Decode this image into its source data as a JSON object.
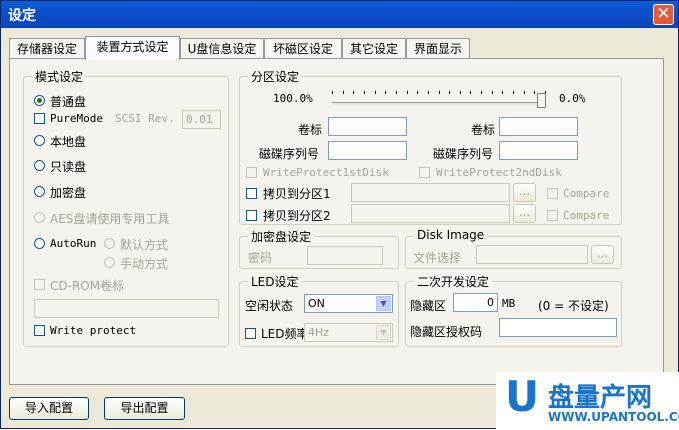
{
  "window": {
    "title": "设定",
    "close_glyph": "✕"
  },
  "tabs": [
    {
      "label": "存储器设定",
      "active": false
    },
    {
      "label": "装置方式设定",
      "active": true
    },
    {
      "label": "U盘信息设定",
      "active": false
    },
    {
      "label": "坏磁区设定",
      "active": false
    },
    {
      "label": "其它设定",
      "active": false
    },
    {
      "label": "界面显示",
      "active": false
    }
  ],
  "mode_group": {
    "legend": "模式设定",
    "normal": "普通盘",
    "puremode": "PureMode",
    "scsi_rev_label": "SCSI Rev.",
    "scsi_rev_value": "0.01",
    "local": "本地盘",
    "readonly": "只读盘",
    "encrypted": "加密盘",
    "aes": "AES盘请使用专用工具",
    "autorun": "AutoRun",
    "default_mode": "默认方式",
    "manual_mode": "手动方式",
    "cdrom_label": "CD-ROM卷标",
    "write_protect": "Write protect"
  },
  "partition_group": {
    "legend": "分区设定",
    "left_percent": "100.0%",
    "right_percent": "0.0%",
    "slider_value_percent": 100,
    "volume_label": "卷标",
    "serial_label": "磁碟序列号",
    "wp1": "WriteProtect1stDisk",
    "wp2": "WriteProtect2ndDisk",
    "copy1": "拷贝到分区1",
    "copy2": "拷贝到分区2",
    "browse": "...",
    "compare": "Compare"
  },
  "encrypt_group": {
    "legend": "加密盘设定",
    "password_label": "密码"
  },
  "disk_image_group": {
    "legend": "Disk Image",
    "file_select_label": "文件选择",
    "browse": "..."
  },
  "led_group": {
    "legend": "LED设定",
    "idle_label": "空闲状态",
    "idle_value": "ON",
    "freq_label": "LED频率",
    "freq_value": "4Hz"
  },
  "dev_group": {
    "legend": "二次开发设定",
    "hidden_label": "隐藏区",
    "hidden_value": "0",
    "hidden_unit": "MB",
    "hidden_note": "(0 = 不设定)",
    "auth_label": "隐藏区授权码"
  },
  "bottom": {
    "import_label": "导入配置",
    "export_label": "导出配置"
  },
  "watermark": {
    "logo_letter": "U",
    "text": "盘量产网",
    "url": "WWW.UPANTOOL.COM"
  },
  "colors": {
    "titlebar": "#0a5fd8",
    "close": "#e15a3a",
    "watermark": "#1a75c9"
  }
}
